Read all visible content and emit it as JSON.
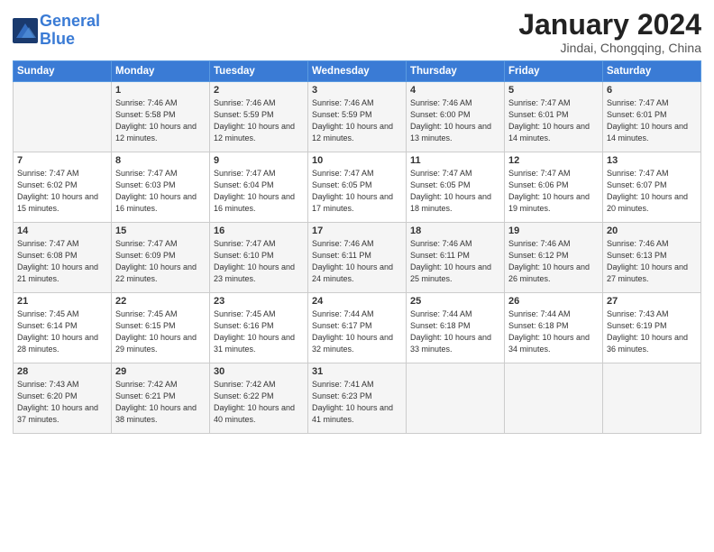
{
  "header": {
    "logo_line1": "General",
    "logo_line2": "Blue",
    "title": "January 2024",
    "location": "Jindai, Chongqing, China"
  },
  "weekdays": [
    "Sunday",
    "Monday",
    "Tuesday",
    "Wednesday",
    "Thursday",
    "Friday",
    "Saturday"
  ],
  "weeks": [
    [
      {
        "day": "",
        "sunrise": "",
        "sunset": "",
        "daylight": ""
      },
      {
        "day": "1",
        "sunrise": "Sunrise: 7:46 AM",
        "sunset": "Sunset: 5:58 PM",
        "daylight": "Daylight: 10 hours and 12 minutes."
      },
      {
        "day": "2",
        "sunrise": "Sunrise: 7:46 AM",
        "sunset": "Sunset: 5:59 PM",
        "daylight": "Daylight: 10 hours and 12 minutes."
      },
      {
        "day": "3",
        "sunrise": "Sunrise: 7:46 AM",
        "sunset": "Sunset: 5:59 PM",
        "daylight": "Daylight: 10 hours and 12 minutes."
      },
      {
        "day": "4",
        "sunrise": "Sunrise: 7:46 AM",
        "sunset": "Sunset: 6:00 PM",
        "daylight": "Daylight: 10 hours and 13 minutes."
      },
      {
        "day": "5",
        "sunrise": "Sunrise: 7:47 AM",
        "sunset": "Sunset: 6:01 PM",
        "daylight": "Daylight: 10 hours and 14 minutes."
      },
      {
        "day": "6",
        "sunrise": "Sunrise: 7:47 AM",
        "sunset": "Sunset: 6:01 PM",
        "daylight": "Daylight: 10 hours and 14 minutes."
      }
    ],
    [
      {
        "day": "7",
        "sunrise": "Sunrise: 7:47 AM",
        "sunset": "Sunset: 6:02 PM",
        "daylight": "Daylight: 10 hours and 15 minutes."
      },
      {
        "day": "8",
        "sunrise": "Sunrise: 7:47 AM",
        "sunset": "Sunset: 6:03 PM",
        "daylight": "Daylight: 10 hours and 16 minutes."
      },
      {
        "day": "9",
        "sunrise": "Sunrise: 7:47 AM",
        "sunset": "Sunset: 6:04 PM",
        "daylight": "Daylight: 10 hours and 16 minutes."
      },
      {
        "day": "10",
        "sunrise": "Sunrise: 7:47 AM",
        "sunset": "Sunset: 6:05 PM",
        "daylight": "Daylight: 10 hours and 17 minutes."
      },
      {
        "day": "11",
        "sunrise": "Sunrise: 7:47 AM",
        "sunset": "Sunset: 6:05 PM",
        "daylight": "Daylight: 10 hours and 18 minutes."
      },
      {
        "day": "12",
        "sunrise": "Sunrise: 7:47 AM",
        "sunset": "Sunset: 6:06 PM",
        "daylight": "Daylight: 10 hours and 19 minutes."
      },
      {
        "day": "13",
        "sunrise": "Sunrise: 7:47 AM",
        "sunset": "Sunset: 6:07 PM",
        "daylight": "Daylight: 10 hours and 20 minutes."
      }
    ],
    [
      {
        "day": "14",
        "sunrise": "Sunrise: 7:47 AM",
        "sunset": "Sunset: 6:08 PM",
        "daylight": "Daylight: 10 hours and 21 minutes."
      },
      {
        "day": "15",
        "sunrise": "Sunrise: 7:47 AM",
        "sunset": "Sunset: 6:09 PM",
        "daylight": "Daylight: 10 hours and 22 minutes."
      },
      {
        "day": "16",
        "sunrise": "Sunrise: 7:47 AM",
        "sunset": "Sunset: 6:10 PM",
        "daylight": "Daylight: 10 hours and 23 minutes."
      },
      {
        "day": "17",
        "sunrise": "Sunrise: 7:46 AM",
        "sunset": "Sunset: 6:11 PM",
        "daylight": "Daylight: 10 hours and 24 minutes."
      },
      {
        "day": "18",
        "sunrise": "Sunrise: 7:46 AM",
        "sunset": "Sunset: 6:11 PM",
        "daylight": "Daylight: 10 hours and 25 minutes."
      },
      {
        "day": "19",
        "sunrise": "Sunrise: 7:46 AM",
        "sunset": "Sunset: 6:12 PM",
        "daylight": "Daylight: 10 hours and 26 minutes."
      },
      {
        "day": "20",
        "sunrise": "Sunrise: 7:46 AM",
        "sunset": "Sunset: 6:13 PM",
        "daylight": "Daylight: 10 hours and 27 minutes."
      }
    ],
    [
      {
        "day": "21",
        "sunrise": "Sunrise: 7:45 AM",
        "sunset": "Sunset: 6:14 PM",
        "daylight": "Daylight: 10 hours and 28 minutes."
      },
      {
        "day": "22",
        "sunrise": "Sunrise: 7:45 AM",
        "sunset": "Sunset: 6:15 PM",
        "daylight": "Daylight: 10 hours and 29 minutes."
      },
      {
        "day": "23",
        "sunrise": "Sunrise: 7:45 AM",
        "sunset": "Sunset: 6:16 PM",
        "daylight": "Daylight: 10 hours and 31 minutes."
      },
      {
        "day": "24",
        "sunrise": "Sunrise: 7:44 AM",
        "sunset": "Sunset: 6:17 PM",
        "daylight": "Daylight: 10 hours and 32 minutes."
      },
      {
        "day": "25",
        "sunrise": "Sunrise: 7:44 AM",
        "sunset": "Sunset: 6:18 PM",
        "daylight": "Daylight: 10 hours and 33 minutes."
      },
      {
        "day": "26",
        "sunrise": "Sunrise: 7:44 AM",
        "sunset": "Sunset: 6:18 PM",
        "daylight": "Daylight: 10 hours and 34 minutes."
      },
      {
        "day": "27",
        "sunrise": "Sunrise: 7:43 AM",
        "sunset": "Sunset: 6:19 PM",
        "daylight": "Daylight: 10 hours and 36 minutes."
      }
    ],
    [
      {
        "day": "28",
        "sunrise": "Sunrise: 7:43 AM",
        "sunset": "Sunset: 6:20 PM",
        "daylight": "Daylight: 10 hours and 37 minutes."
      },
      {
        "day": "29",
        "sunrise": "Sunrise: 7:42 AM",
        "sunset": "Sunset: 6:21 PM",
        "daylight": "Daylight: 10 hours and 38 minutes."
      },
      {
        "day": "30",
        "sunrise": "Sunrise: 7:42 AM",
        "sunset": "Sunset: 6:22 PM",
        "daylight": "Daylight: 10 hours and 40 minutes."
      },
      {
        "day": "31",
        "sunrise": "Sunrise: 7:41 AM",
        "sunset": "Sunset: 6:23 PM",
        "daylight": "Daylight: 10 hours and 41 minutes."
      },
      {
        "day": "",
        "sunrise": "",
        "sunset": "",
        "daylight": ""
      },
      {
        "day": "",
        "sunrise": "",
        "sunset": "",
        "daylight": ""
      },
      {
        "day": "",
        "sunrise": "",
        "sunset": "",
        "daylight": ""
      }
    ]
  ]
}
